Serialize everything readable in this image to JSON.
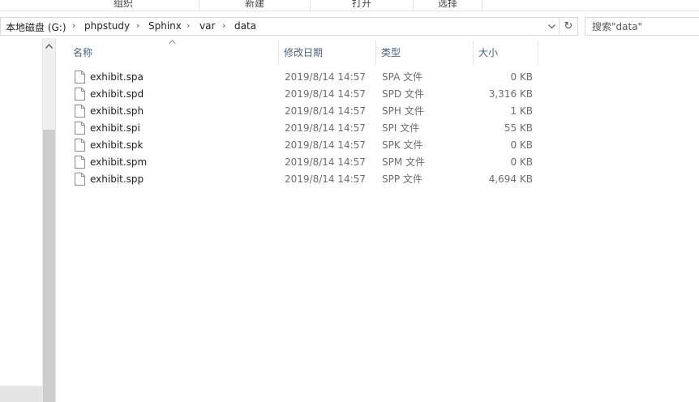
{
  "ribbon": {
    "groups": [
      "组织",
      "新建",
      "打开",
      "选择"
    ]
  },
  "address_bar": {
    "crumbs": [
      "本地磁盘 (G:)",
      "phpstudy",
      "Sphinx",
      "var",
      "data"
    ],
    "separator_icon": "chevron-right-icon",
    "dropdown_icon": "chevron-down-icon",
    "refresh_icon": "refresh-icon"
  },
  "search": {
    "placeholder": "搜索\"data\""
  },
  "columns": {
    "name": "名称",
    "date": "修改日期",
    "type": "类型",
    "size": "大小"
  },
  "files": [
    {
      "name": "exhibit.spa",
      "date": "2019/8/14 14:57",
      "type": "SPA 文件",
      "size": "0 KB"
    },
    {
      "name": "exhibit.spd",
      "date": "2019/8/14 14:57",
      "type": "SPD 文件",
      "size": "3,316 KB"
    },
    {
      "name": "exhibit.sph",
      "date": "2019/8/14 14:57",
      "type": "SPH 文件",
      "size": "1 KB"
    },
    {
      "name": "exhibit.spi",
      "date": "2019/8/14 14:57",
      "type": "SPI 文件",
      "size": "55 KB"
    },
    {
      "name": "exhibit.spk",
      "date": "2019/8/14 14:57",
      "type": "SPK 文件",
      "size": "0 KB"
    },
    {
      "name": "exhibit.spm",
      "date": "2019/8/14 14:57",
      "type": "SPM 文件",
      "size": "0 KB"
    },
    {
      "name": "exhibit.spp",
      "date": "2019/8/14 14:57",
      "type": "SPP 文件",
      "size": "4,694 KB"
    }
  ]
}
